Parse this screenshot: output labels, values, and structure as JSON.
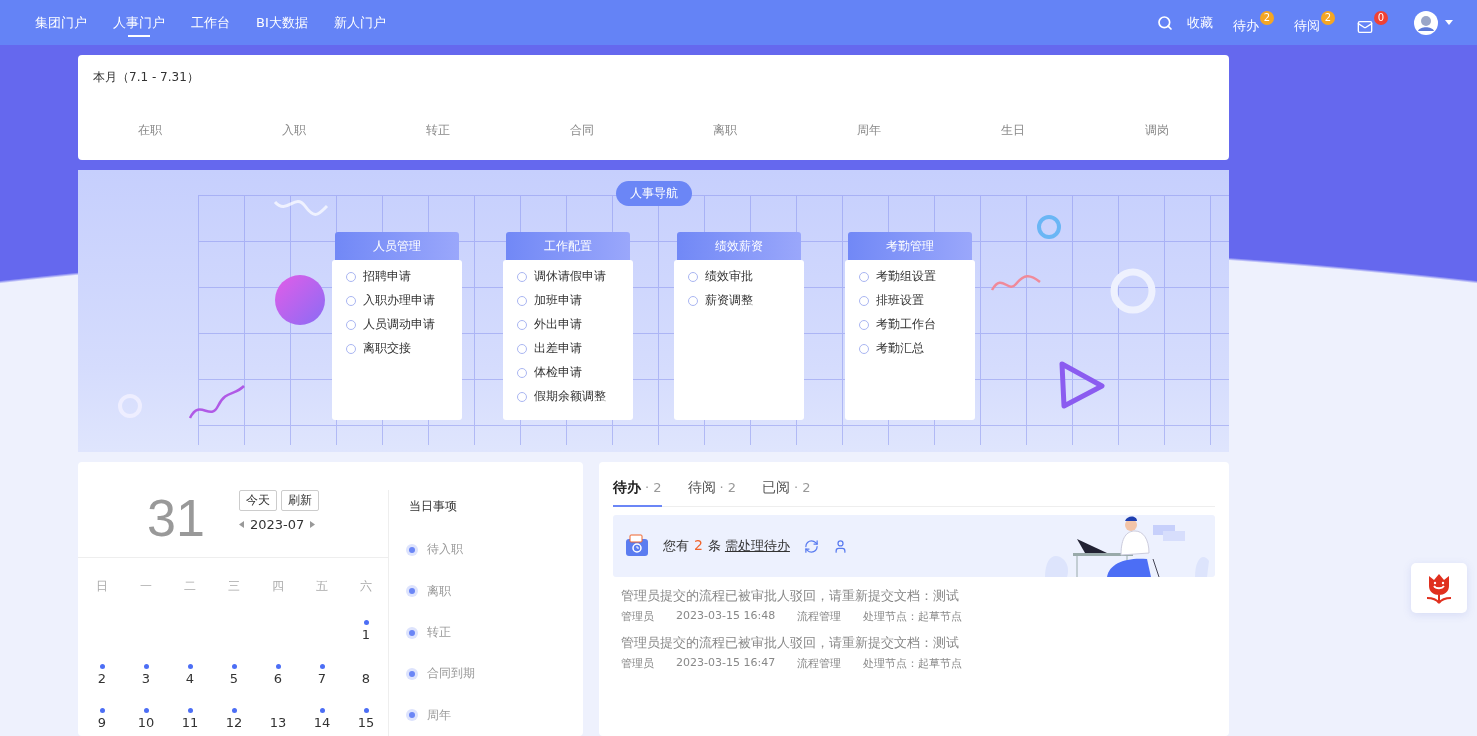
{
  "nav": {
    "tabs": [
      {
        "label": "集团门户",
        "selected": false
      },
      {
        "label": "人事门户",
        "selected": true
      },
      {
        "label": "工作台",
        "selected": false
      },
      {
        "label": "BI大数据",
        "selected": false
      },
      {
        "label": "新人门户",
        "selected": false
      }
    ],
    "actions": [
      {
        "kind": "search"
      },
      {
        "kind": "text",
        "label": "收藏"
      },
      {
        "kind": "badge",
        "label": "待办",
        "count": "2",
        "color": "#f5a623"
      },
      {
        "kind": "badge",
        "label": "待阅",
        "count": "2",
        "color": "#f5a623"
      },
      {
        "kind": "mail",
        "count": "0",
        "color": "#f04134"
      },
      {
        "kind": "avatar"
      }
    ]
  },
  "stats": {
    "title": "本月（7.1 - 7.31）",
    "items": [
      "在职",
      "入职",
      "转正",
      "合同",
      "离职",
      "周年",
      "生日",
      "调岗"
    ]
  },
  "hr_nav": {
    "title": "人事导航",
    "groups": [
      {
        "title": "人员管理",
        "items": [
          "招聘申请",
          "入职办理申请",
          "人员调动申请",
          "离职交接"
        ]
      },
      {
        "title": "工作配置",
        "items": [
          "调休请假申请",
          "加班申请",
          "外出申请",
          "出差申请",
          "体检申请",
          "假期余额调整"
        ]
      },
      {
        "title": "绩效薪资",
        "items": [
          "绩效审批",
          "薪资调整"
        ]
      },
      {
        "title": "考勤管理",
        "items": [
          "考勤组设置",
          "排班设置",
          "考勤工作台",
          "考勤汇总"
        ]
      }
    ]
  },
  "calendar": {
    "day": "31",
    "buttons": [
      "今天",
      "刷新"
    ],
    "month": "2023-07",
    "weekdays": [
      "日",
      "一",
      "二",
      "三",
      "四",
      "五",
      "六"
    ],
    "weeks": [
      [
        {
          "label": "1",
          "event": true
        }
      ],
      [
        {
          "label": "2",
          "event": true
        },
        {
          "label": "3",
          "event": true
        },
        {
          "label": "4",
          "event": true
        },
        {
          "label": "5",
          "event": true
        },
        {
          "label": "6",
          "event": true
        },
        {
          "label": "7",
          "event": true
        },
        {
          "label": "8",
          "event": false
        }
      ],
      [
        {
          "label": "9",
          "event": true
        },
        {
          "label": "10",
          "event": true
        },
        {
          "label": "11",
          "event": true
        },
        {
          "label": "12",
          "event": true
        },
        {
          "label": "13",
          "event": false
        },
        {
          "label": "14",
          "event": true
        },
        {
          "label": "15",
          "event": true
        }
      ]
    ]
  },
  "events": {
    "title": "当日事项",
    "items": [
      "待入职",
      "离职",
      "转正",
      "合同到期",
      "周年"
    ]
  },
  "todo": {
    "tabs": [
      {
        "label": "待办",
        "count": "· 2",
        "selected": true
      },
      {
        "label": "待阅",
        "count": "· 2",
        "selected": false
      },
      {
        "label": "已阅",
        "count": "· 2",
        "selected": false
      }
    ],
    "banner": {
      "prefix": "您有",
      "count": "2",
      "suffix": "条",
      "link": "需处理待办"
    },
    "items": [
      {
        "title": "管理员提交的流程已被审批人驳回，请重新提交文档：测试",
        "author": "管理员",
        "time": "2023-03-15 16:48",
        "module": "流程管理",
        "node": "处理节点：起草节点"
      },
      {
        "title": "管理员提交的流程已被审批人驳回，请重新提交文档：测试",
        "author": "管理员",
        "time": "2023-03-15 16:47",
        "module": "流程管理",
        "node": "处理节点：起草节点"
      }
    ]
  }
}
